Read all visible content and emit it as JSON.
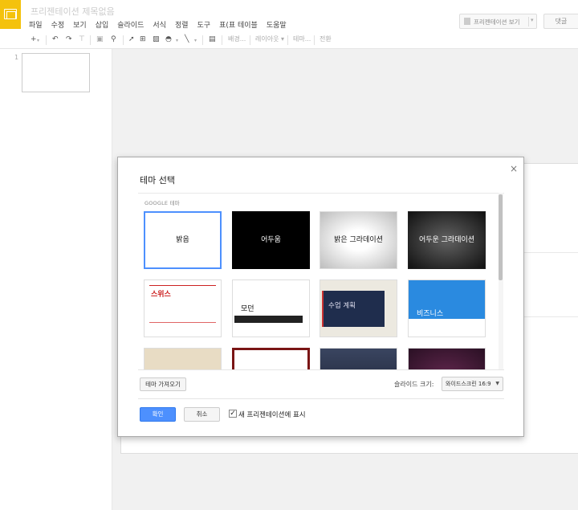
{
  "app": {
    "doc_title": "프리젠테이션 제목없음",
    "menu": [
      "파일",
      "수정",
      "보기",
      "삽입",
      "슬라이드",
      "서식",
      "정렬",
      "도구",
      "표(표 테이블",
      "도움말"
    ],
    "present_label": "프리젠테이션 보기",
    "comments_label": "댓글"
  },
  "toolbar": {
    "background_label": "배경...",
    "layout_label": "레이아웃 ▾",
    "theme_label": "테마...",
    "transition_label": "전환"
  },
  "filmstrip": {
    "slide_number": "1"
  },
  "dialog": {
    "title": "테마 선택",
    "close_icon": "×",
    "section_label": "GOOGLE 테마",
    "themes": [
      {
        "name": "밝음",
        "selected": true
      },
      {
        "name": "어두움",
        "selected": false
      },
      {
        "name": "밝은 그라데이션",
        "selected": false
      },
      {
        "name": "어두운 그라데이션",
        "selected": false
      },
      {
        "name": "스위스",
        "selected": false
      },
      {
        "name": "모던",
        "selected": false
      },
      {
        "name": "수업 계획",
        "selected": false
      },
      {
        "name": "비즈니스",
        "selected": false
      }
    ],
    "import_label": "테마 가져오기",
    "size_label": "슬라이드 크기:",
    "size_value": "와이드스크린 16:9",
    "ok_label": "확인",
    "cancel_label": "취소",
    "show_label": "새 프리젠테이션에 표시",
    "show_checked": true
  }
}
